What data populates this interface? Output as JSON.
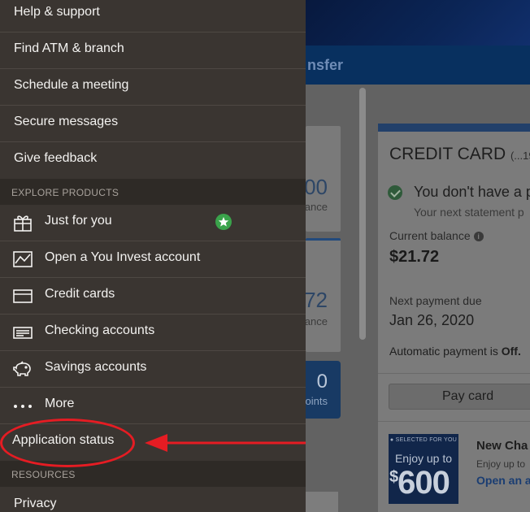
{
  "menu": {
    "items_top": [
      {
        "label": "Help & support"
      },
      {
        "label": "Find ATM & branch"
      },
      {
        "label": "Schedule a meeting"
      },
      {
        "label": "Secure messages"
      },
      {
        "label": "Give feedback"
      }
    ],
    "explore_header": "EXPLORE PRODUCTS",
    "explore_items": [
      {
        "label": "Just for you",
        "icon": "gift-icon",
        "badge_icon": "star-badge-icon"
      },
      {
        "label": "Open a You Invest account",
        "icon": "chart-line-icon"
      },
      {
        "label": "Credit cards",
        "icon": "credit-card-icon"
      },
      {
        "label": "Checking accounts",
        "icon": "checking-icon"
      },
      {
        "label": "Savings accounts",
        "icon": "piggy-bank-icon"
      },
      {
        "label": "More",
        "icon": "more-dots-icon"
      },
      {
        "label": "Application status"
      }
    ],
    "resources_header": "RESOURCES",
    "resources_items": [
      {
        "label": "Privacy"
      }
    ]
  },
  "background": {
    "nav_partial": "nsfer",
    "left_cards": [
      {
        "value": "00",
        "sub": "ance"
      },
      {
        "value": "72",
        "sub": "ance"
      }
    ],
    "rewards": {
      "value": "0",
      "sub": "oints"
    },
    "credit_card": {
      "title": "CREDIT CARD",
      "account": "(...19",
      "status": "You don't have a p",
      "statement": "Your next statement p",
      "current_balance_label": "Current balance",
      "current_balance": "$21.72",
      "next_payment_label": "Next payment due",
      "next_payment_date": "Jan 26, 2020",
      "autopay_text": "Automatic payment is",
      "autopay_value": "Off.",
      "pay_button": "Pay card",
      "promo": {
        "selected": "SELECTED FOR YOU",
        "enjoy": "Enjoy up to",
        "amount_symbol": "$",
        "amount": "600",
        "title": "New Cha",
        "sub": "Enjoy up to",
        "link": "Open an a"
      }
    }
  },
  "annotation": {
    "color": "#e51c23"
  },
  "colors": {
    "menu_bg": "#3a3531",
    "section_bg": "#2e2a26",
    "badge": "#3aa34b"
  }
}
